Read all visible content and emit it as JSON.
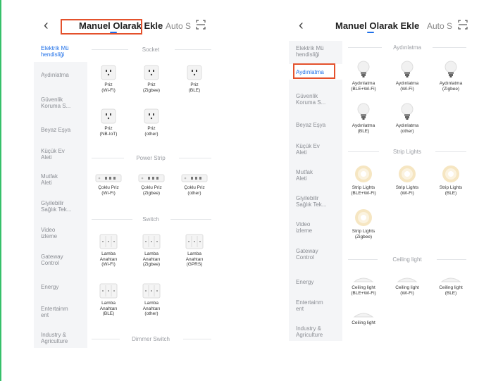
{
  "left": {
    "title": "Manuel Olarak Ekle",
    "autoscan": "Auto S",
    "sidebar": [
      "Elektrik Mü\nhendisliği",
      "Aydınlatma",
      "Güvenlik\nKoruma S...",
      "Beyaz Eşya",
      "Küçük Ev\nAleti",
      "Mutfak\nAleti",
      "Giyilebilir\nSağlık Tek...",
      "Video\nizleme",
      "Gateway\nControl",
      "Energy",
      "Entertainm\nent",
      "Industry &\nAgriculture"
    ],
    "sections": {
      "socket": "Socket",
      "power_strip": "Power Strip",
      "switch": "Switch",
      "dimmer": "Dimmer Switch"
    },
    "devices": {
      "priz_wifi": "Priz\n(Wi-Fi)",
      "priz_zigbee": "Priz\n(Zigbee)",
      "priz_ble": "Priz\n(BLE)",
      "priz_nbiot": "Priz\n(NB-IoT)",
      "priz_other": "Priz\n(other)",
      "coklu_wifi": "Çoklu Priz\n(Wi-Fi)",
      "coklu_zigbee": "Çoklu Priz\n(Zigbee)",
      "coklu_other": "Çoklu Priz\n(other)",
      "lamba_wifi": "Lamba\nAnahtarı\n(Wi-Fi)",
      "lamba_zigbee": "Lamba\nAnahtarı\n(Zigbee)",
      "lamba_gprs": "Lamba\nAnahtarı\n(GPRS)",
      "lamba_ble": "Lamba\nAnahtarı\n(BLE)",
      "lamba_other": "Lamba\nAnahtarı\n(other)"
    }
  },
  "right": {
    "title": "Manuel Olarak Ekle",
    "autoscan": "Auto S",
    "sidebar": [
      "Elektrik Mü\nhendisliği",
      "Aydınlatma",
      "Güvenlik\nKoruma S...",
      "Beyaz Eşya",
      "Küçük Ev\nAleti",
      "Mutfak\nAleti",
      "Giyilebilir\nSağlık Tek...",
      "Video\nizleme",
      "Gateway\nControl",
      "Energy",
      "Entertainm\nent",
      "Industry &\nAgriculture"
    ],
    "sections": {
      "lighting": "Aydınlatma",
      "strip": "Strip Lights",
      "ceiling": "Ceiling light"
    },
    "devices": {
      "ayd_blewifi": "Aydınlatma\n(BLE+Wi-Fi)",
      "ayd_wifi": "Aydınlatma\n(Wi-Fi)",
      "ayd_zigbee": "Aydınlatma\n(Zigbee)",
      "ayd_ble": "Aydınlatma\n(BLE)",
      "ayd_other": "Aydınlatma\n(other)",
      "strip_blewifi": "Strip Lights\n(BLE+Wi-Fi)",
      "strip_wifi": "Strip Lights\n(Wi-Fi)",
      "strip_ble": "Strip Lights\n(BLE)",
      "strip_zigbee": "Strip Lights\n(Zigbee)",
      "ceil_blewifi": "Ceiling light\n(BLE+Wi-Fi)",
      "ceil_wifi": "Ceiling light\n(Wi-Fi)",
      "ceil_ble": "Ceiling light\n(BLE)",
      "ceil_partial": "Ceiling light"
    }
  },
  "colors": {
    "accent": "#1e6fe8",
    "highlight": "#e4512c",
    "sidebar_bg": "#f4f5f7"
  }
}
